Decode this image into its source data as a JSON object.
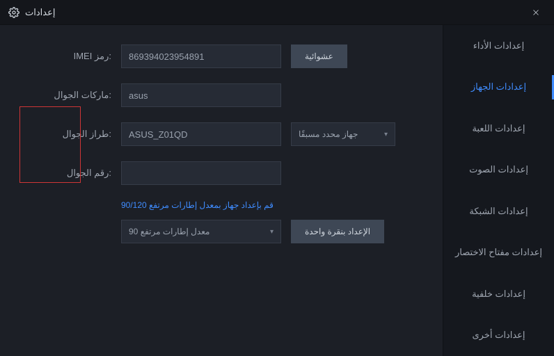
{
  "titlebar": {
    "title": "إعدادات"
  },
  "sidebar": {
    "items": [
      {
        "label": "إعدادات الأداء"
      },
      {
        "label": "إعدادات الجهاز"
      },
      {
        "label": "إعدادات اللعبة"
      },
      {
        "label": "إعدادات الصوت"
      },
      {
        "label": "إعدادات الشبكة"
      },
      {
        "label": "إعدادات مفتاح الاختصار"
      },
      {
        "label": "إعدادات خلفية"
      },
      {
        "label": "إعدادات أخرى"
      }
    ],
    "active_index": 1
  },
  "fields": {
    "imei": {
      "label": "IMEI رمز:",
      "value": "869394023954891"
    },
    "random_btn": "عشوائية",
    "brand": {
      "label": "ماركات الجوال:",
      "value": "asus"
    },
    "model": {
      "label": "طراز الجوال:",
      "value": "ASUS_Z01QD"
    },
    "model_select": "جهاز محدد مسبقًا",
    "phone_number": {
      "label": "رقم الجوال:",
      "value": ""
    },
    "fps_hint": "قم بإعداد جهاز بمعدل إطارات مرتفع 90/120",
    "fps_select": "معدل إطارات مرتفع 90",
    "one_click_btn": "الإعداد بنقرة واحدة"
  }
}
